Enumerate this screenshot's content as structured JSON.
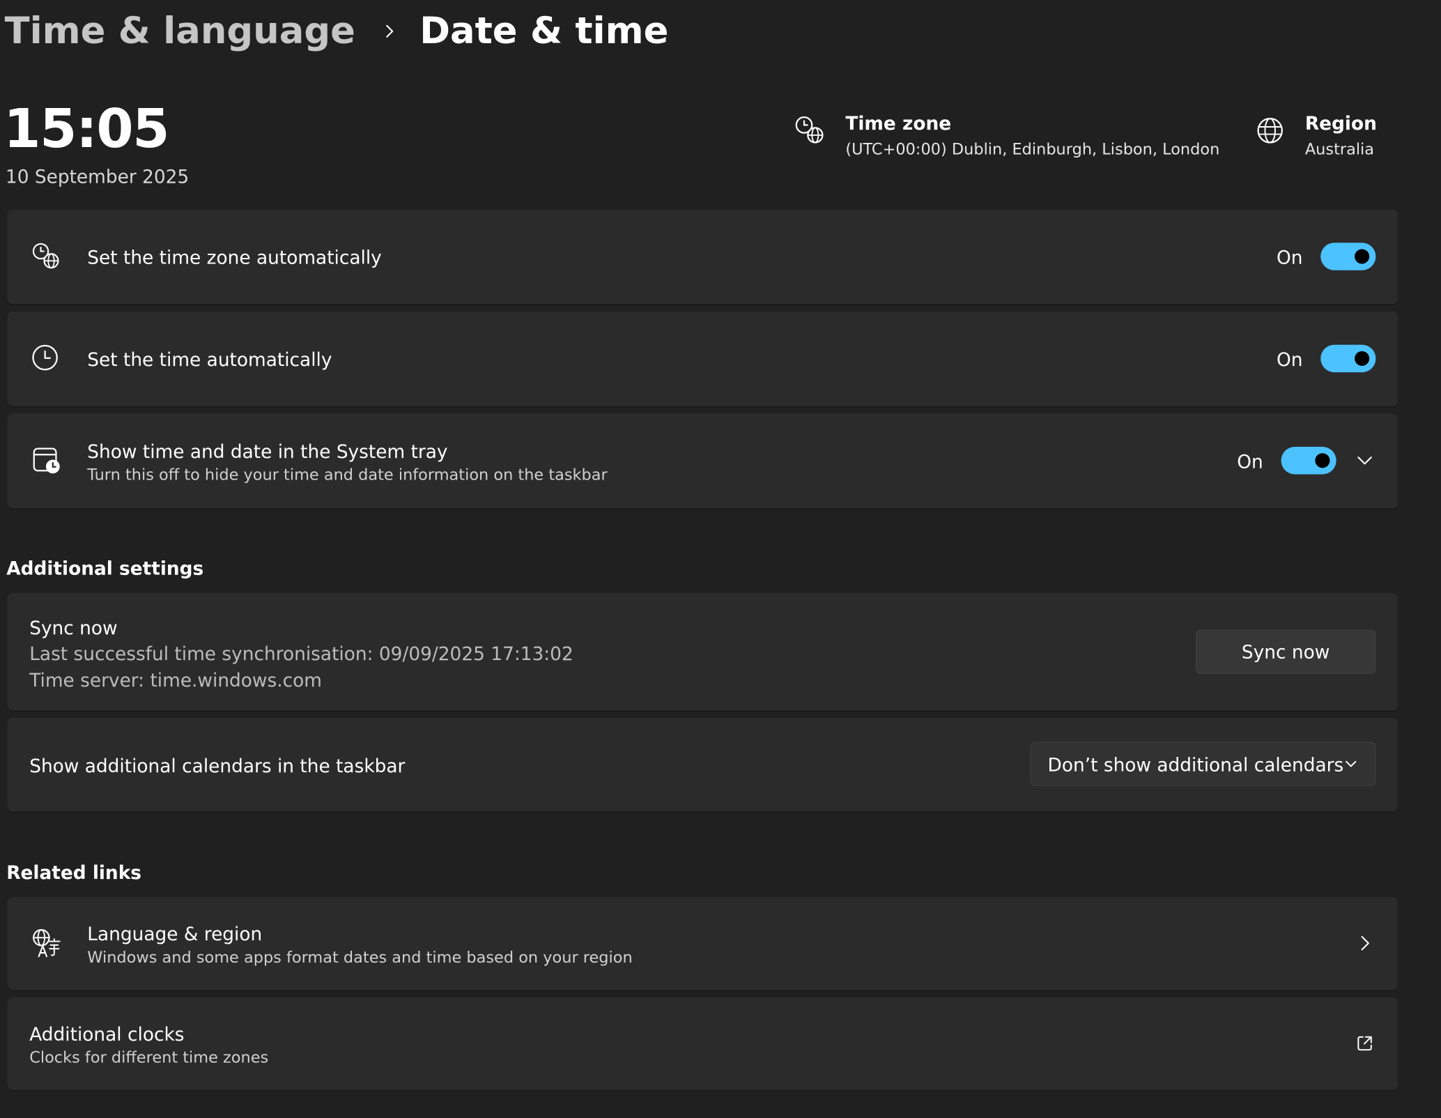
{
  "breadcrumb": {
    "parent": "Time & language",
    "current": "Date & time"
  },
  "clock": {
    "time": "15:05",
    "date": "10 September 2025"
  },
  "time_zone_info": {
    "title": "Time zone",
    "value": "(UTC+00:00) Dublin, Edinburgh, Lisbon, London",
    "icon": "clock-globe-icon"
  },
  "region_info": {
    "title": "Region",
    "value": "Australia",
    "icon": "globe-icon"
  },
  "settings": [
    {
      "label": "Set the time zone automatically",
      "state": "On",
      "enabled": true,
      "icon": "clock-globe-icon"
    },
    {
      "label": "Set the time automatically",
      "state": "On",
      "enabled": true,
      "icon": "clock-icon"
    },
    {
      "label": "Show time and date in the System tray",
      "description": "Turn this off to hide your time and date information on the taskbar",
      "state": "On",
      "enabled": true,
      "icon": "calendar-clock-icon"
    }
  ],
  "additional_settings": {
    "heading": "Additional settings",
    "sync": {
      "title": "Sync now",
      "last_sync": "Last successful time synchronisation: 09/09/2025 17:13:02",
      "server": "Time server: time.windows.com",
      "button_label": "Sync now"
    },
    "calendars": {
      "label": "Show additional calendars in the taskbar",
      "selected": "Don’t show additional calendars"
    }
  },
  "related_links": {
    "heading": "Related links",
    "items": [
      {
        "title": "Language & region",
        "description": "Windows and some apps format dates and time based on your region",
        "icon": "language-icon",
        "action_icon": "chevron-right-icon"
      },
      {
        "title": "Additional clocks",
        "description": "Clocks for different time zones",
        "action_icon": "open-external-icon"
      }
    ]
  },
  "colors": {
    "background": "#202020",
    "card": "#2b2b2b",
    "accent": "#4cc2ff"
  }
}
